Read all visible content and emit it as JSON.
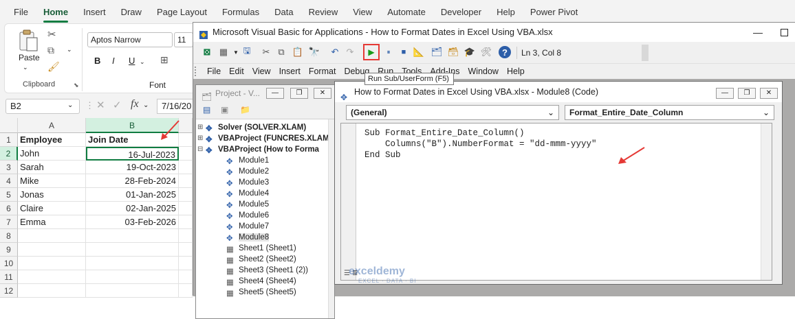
{
  "excel": {
    "tabs": [
      "File",
      "Home",
      "Insert",
      "Draw",
      "Page Layout",
      "Formulas",
      "Data",
      "Review",
      "View",
      "Automate",
      "Developer",
      "Help",
      "Power Pivot"
    ],
    "active_tab": "Home",
    "clipboard": {
      "paste_label": "Paste",
      "group_label": "Clipboard"
    },
    "font": {
      "name": "Aptos Narrow",
      "size": "11",
      "group_label": "Font",
      "bold": "B",
      "italic": "I"
    },
    "name_box": "B2",
    "formula_value": "7/16/20",
    "columns": [
      "A",
      "B"
    ],
    "rows": [
      {
        "n": "1",
        "a": "Employee",
        "b": "Join Date"
      },
      {
        "n": "2",
        "a": "John",
        "b": "16-Jul-2023"
      },
      {
        "n": "3",
        "a": "Sarah",
        "b": "19-Oct-2023"
      },
      {
        "n": "4",
        "a": "Mike",
        "b": "28-Feb-2024"
      },
      {
        "n": "5",
        "a": "Jonas",
        "b": "01-Jan-2025"
      },
      {
        "n": "6",
        "a": "Claire",
        "b": "02-Jan-2025"
      },
      {
        "n": "7",
        "a": "Emma",
        "b": "03-Feb-2026"
      },
      {
        "n": "8",
        "a": "",
        "b": ""
      },
      {
        "n": "9",
        "a": "",
        "b": ""
      },
      {
        "n": "10",
        "a": "",
        "b": ""
      },
      {
        "n": "11",
        "a": "",
        "b": ""
      },
      {
        "n": "12",
        "a": "",
        "b": ""
      }
    ]
  },
  "vbe": {
    "title": "Microsoft Visual Basic for Applications - How to Format Dates in Excel Using VBA.xlsx",
    "position": "Ln 3, Col 8",
    "tooltip": "Run Sub/UserForm (F5)",
    "menu": [
      "File",
      "Edit",
      "View",
      "Insert",
      "Format",
      "Debug",
      "Run",
      "Tools",
      "Add-Ins",
      "Window",
      "Help"
    ],
    "project": {
      "title": "Project - V...",
      "items": [
        {
          "label": "Solver (SOLVER.XLAM)",
          "kind": "project"
        },
        {
          "label": "VBAProject (FUNCRES.XLAM",
          "kind": "project"
        },
        {
          "label": "VBAProject (How to Forma",
          "kind": "project"
        },
        {
          "label": "Module1",
          "kind": "module"
        },
        {
          "label": "Module2",
          "kind": "module"
        },
        {
          "label": "Module3",
          "kind": "module"
        },
        {
          "label": "Module4",
          "kind": "module"
        },
        {
          "label": "Module5",
          "kind": "module"
        },
        {
          "label": "Module6",
          "kind": "module"
        },
        {
          "label": "Module7",
          "kind": "module"
        },
        {
          "label": "Module8",
          "kind": "module"
        },
        {
          "label": "Sheet1 (Sheet1)",
          "kind": "sheet"
        },
        {
          "label": "Sheet2 (Sheet2)",
          "kind": "sheet"
        },
        {
          "label": "Sheet3 (Sheet1 (2))",
          "kind": "sheet"
        },
        {
          "label": "Sheet4 (Sheet4)",
          "kind": "sheet"
        },
        {
          "label": "Sheet5 (Sheet5)",
          "kind": "sheet"
        }
      ]
    },
    "code_window": {
      "title": "How to Format Dates in Excel Using VBA.xlsx - Module8 (Code)",
      "object_combo": "(General)",
      "proc_combo": "Format_Entire_Date_Column",
      "lines": [
        "Sub Format_Entire_Date_Column()",
        "    Columns(\"B\").NumberFormat = \"dd-mmm-yyyy\"",
        "End Sub"
      ]
    }
  },
  "watermark": {
    "name": "exceldemy",
    "tagline": "EXCEL · DATA · BI"
  },
  "colors": {
    "excel_green": "#107c41",
    "highlight_red": "#e53935",
    "run_green": "#1a9c1a"
  }
}
